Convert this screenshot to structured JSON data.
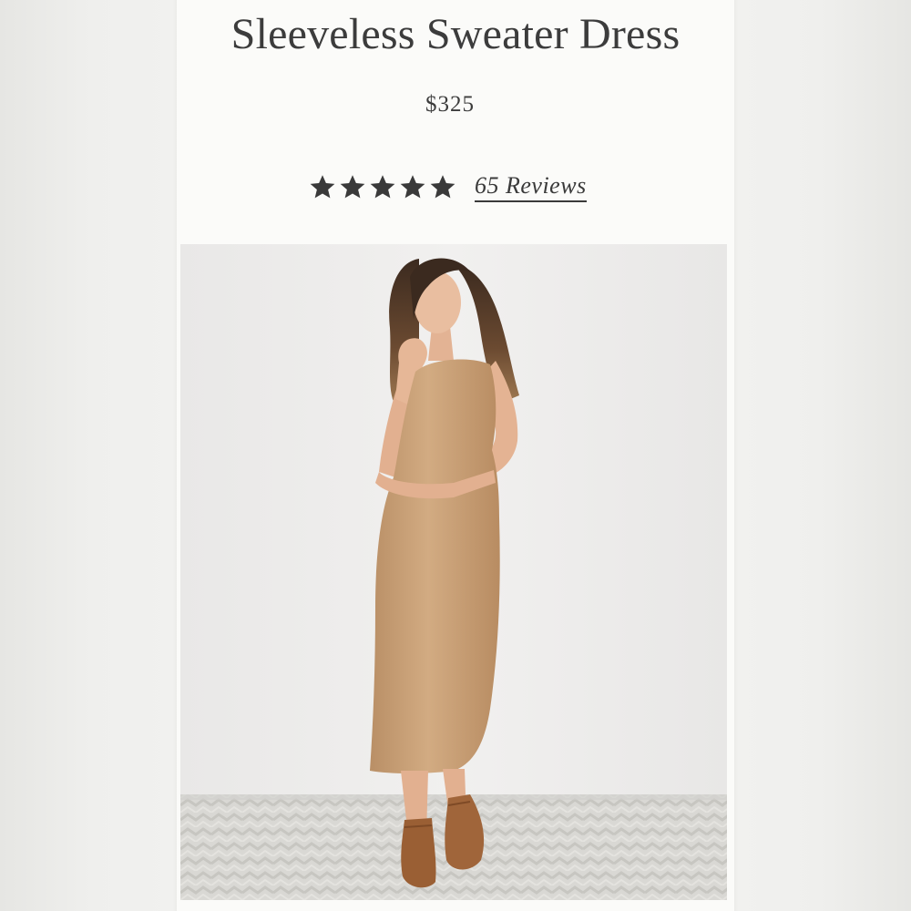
{
  "product": {
    "title": "Sleeveless Sweater Dress",
    "price": "$325",
    "rating": 5,
    "rating_max": 5,
    "reviews_label": "65 Reviews"
  },
  "image": {
    "subject": "model-wearing-camel-sleeveless-sweater-dress",
    "dress_color": "#c9a27a",
    "boots_color": "#9a5f34"
  },
  "colors": {
    "text": "#3c3c3c",
    "panel_bg": "#fbfbf9",
    "page_bg": "#ededeb"
  }
}
